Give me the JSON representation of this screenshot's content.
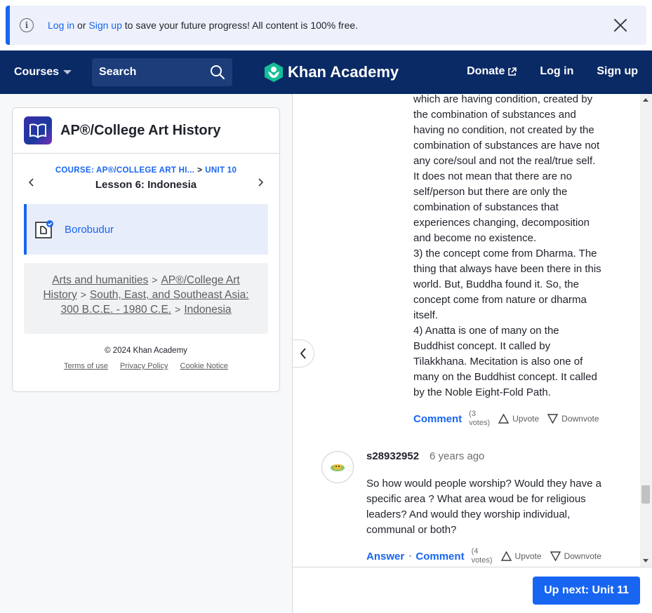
{
  "banner": {
    "login": "Log in",
    "or": "or",
    "signup": "Sign up",
    "rest": "to save your future progress! All content is 100% free."
  },
  "header": {
    "courses": "Courses",
    "search_placeholder": "Search",
    "logo_text": "Khan Academy",
    "donate": "Donate",
    "login": "Log in",
    "signup": "Sign up",
    "bar_color": "#0a2a66"
  },
  "sidebar": {
    "course_title": "AP®/College Art History",
    "crumb_course": "COURSE: AP®/COLLEGE ART HI...",
    "crumb_sep": ">",
    "crumb_unit": "UNIT 10",
    "lesson_title": "Lesson 6: Indonesia",
    "item_label": "Borobudur",
    "topic_links": [
      "Arts and humanities",
      "AP®/College Art History",
      "South, East, and Southeast Asia: 300 B.C.E. - 1980 C.E.",
      "Indonesia"
    ],
    "topic_sep": ">",
    "copyright": "© 2024 Khan Academy",
    "footer_links": [
      "Terms of use",
      "Privacy Policy",
      "Cookie Notice"
    ]
  },
  "answer": {
    "lines": [
      "which are having condition, created by",
      "the combination of substances and",
      "having no condition, not created by the",
      "combination of substances are have not",
      "any core/soul and not the real/true self.",
      "It does not mean that there are no",
      "self/person but there are only the",
      "combination of substances that",
      "experiences changing, decomposition",
      "and become no existence.",
      "3) the concept come from Dharma. The",
      "thing that always have been there in this",
      "world. But, Buddha found it. So, the",
      "concept come from nature or dharma",
      "itself.",
      "4) Anatta is one of many on the",
      "Buddhist concept. It called by",
      "Tilakkhana. Mecitation is also one of",
      "many on the Buddhist concept. It called",
      "by the Noble Eight-Fold Path."
    ],
    "comment": "Comment",
    "votes_top": "(3",
    "votes_bottom": "votes)",
    "upvote": "Upvote",
    "downvote": "Downvote"
  },
  "question": {
    "username": "s28932952",
    "time": "6 years ago",
    "text": "So how would people worship? Would they have a specific area ? What area woud be for religious leaders? And would they worship individual, communal or both?",
    "answer": "Answer",
    "dot": "•",
    "comment": "Comment",
    "votes_top": "(4",
    "votes_bottom": "votes)",
    "upvote": "Upvote",
    "downvote": "Downvote"
  },
  "bottom": {
    "up_next": "Up next: Unit 11"
  },
  "colors": {
    "accent": "#1865f2",
    "header_bg": "#0a2a66",
    "logo_green": "#14bf96"
  },
  "icons": [
    "info-icon",
    "close-icon",
    "chevron-down-icon",
    "search-icon",
    "khan-logo-icon",
    "external-link-icon",
    "book-icon",
    "chevron-left-icon",
    "chevron-right-icon",
    "article-check-icon",
    "upvote-icon",
    "downvote-icon",
    "avatar-icon"
  ]
}
